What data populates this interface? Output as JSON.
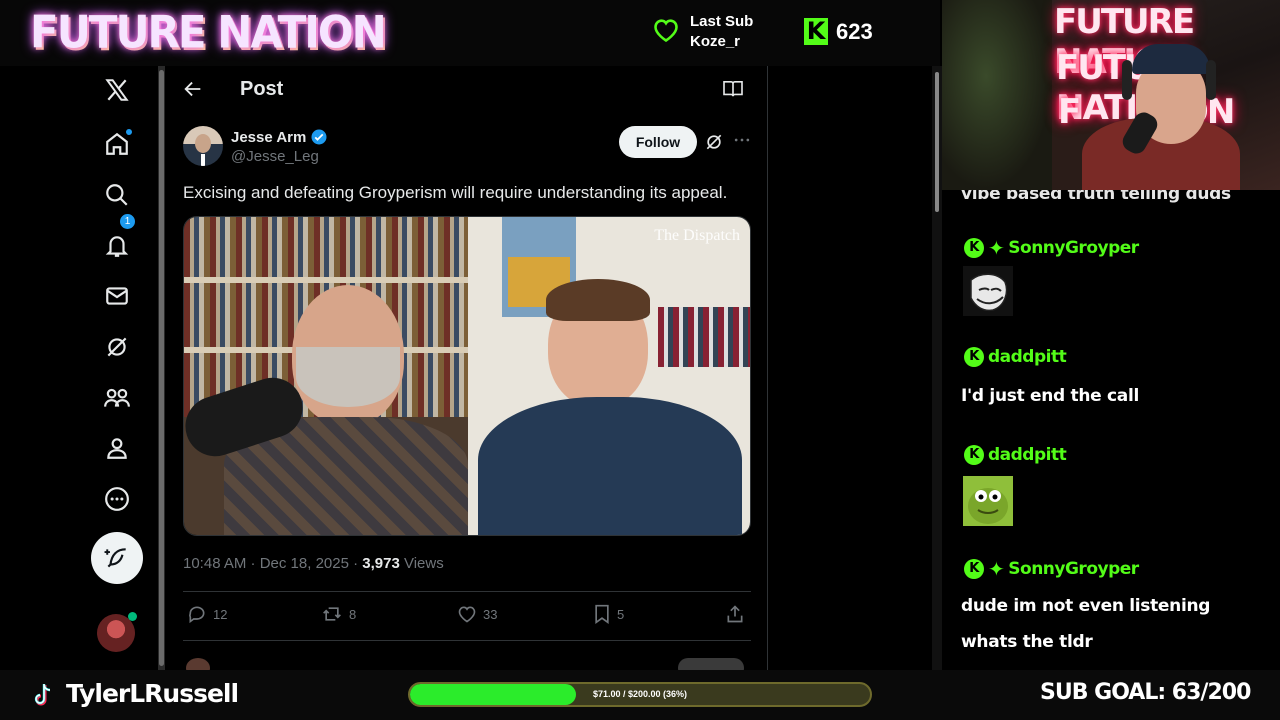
{
  "stream": {
    "brand": "FUTURE NATION",
    "last_sub_label": "Last Sub",
    "last_sub_user": "Koze_r",
    "kick_count": "623",
    "accent": "#53fc18"
  },
  "x": {
    "nav_icons": [
      "x-logo-icon",
      "home-icon",
      "search-icon",
      "notifications-icon",
      "messages-icon",
      "grok-icon",
      "communities-icon",
      "profile-icon",
      "more-icon"
    ],
    "messages_badge": "1",
    "header_title": "Post",
    "author": {
      "name": "Jesse Arm",
      "handle": "@Jesse_Leg",
      "verified": true
    },
    "follow_label": "Follow",
    "post_text": "Excising and defeating Groyperism will require understanding its appeal.",
    "media_watermark": "The Dispatch",
    "timestamp": "10:48 AM · Dec 18, 2025 · ",
    "views_count": "3,973",
    "views_label": " Views",
    "replies": "12",
    "reposts": "8",
    "likes": "33",
    "bookmarks": "5"
  },
  "webcam": {
    "neon_lines": [
      "FUTURE NATION",
      "FUTURE NATION",
      "F       TION"
    ]
  },
  "chat": {
    "partial_line": "vibe based truth telling duds",
    "messages": [
      {
        "user": "SonnyGroyper",
        "text": "",
        "emote": "trollface"
      },
      {
        "user": "daddpitt",
        "text": "I'd just end the call",
        "emote": ""
      },
      {
        "user": "daddpitt",
        "text": "",
        "emote": "green-cartoon"
      },
      {
        "user": "SonnyGroyper",
        "text": "dude im not even listening whats the tldr",
        "emote": ""
      }
    ]
  },
  "footer": {
    "streamer": "TylerLRussell",
    "goal_text": "$71.00 / $200.00 (36%)",
    "goal_progress": 0.36,
    "sub_goal": "SUB GOAL: 63/200"
  }
}
